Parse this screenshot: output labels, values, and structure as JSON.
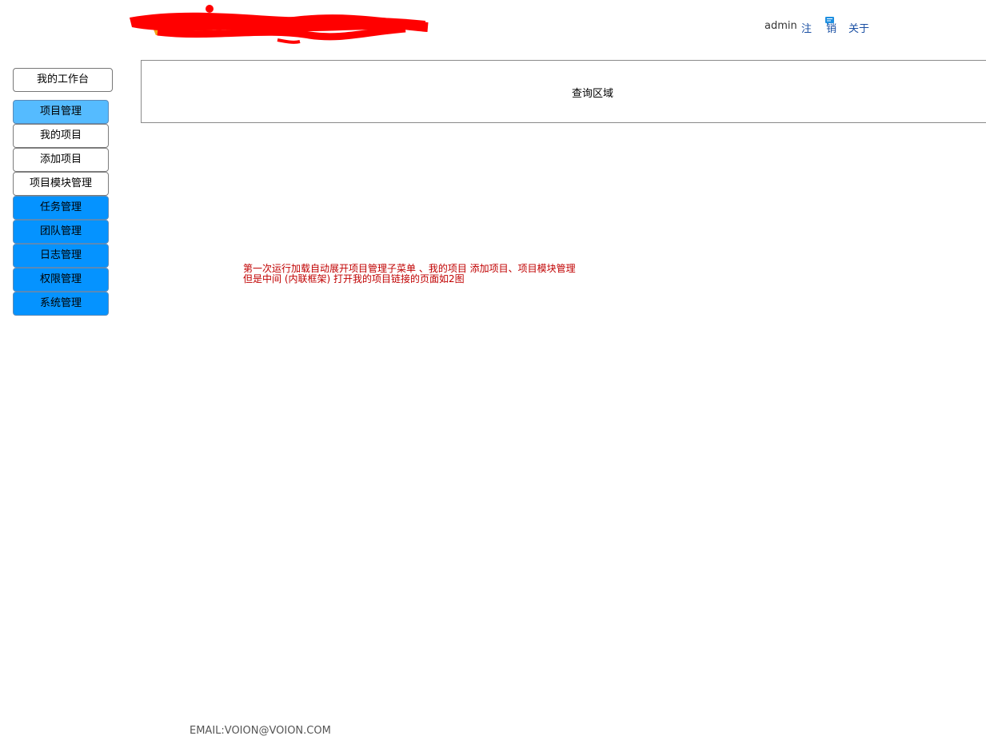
{
  "header": {
    "user": "admin",
    "logout": "注 销",
    "about": "关于"
  },
  "sidebar": {
    "workbench": "我的工作台",
    "menu": [
      {
        "label": "项目管理",
        "kind": "group",
        "active": true
      },
      {
        "label": "我的项目",
        "kind": "sub"
      },
      {
        "label": "添加项目",
        "kind": "sub"
      },
      {
        "label": "项目模块管理",
        "kind": "sub"
      },
      {
        "label": "任务管理",
        "kind": "group"
      },
      {
        "label": "团队管理",
        "kind": "group"
      },
      {
        "label": "日志管理",
        "kind": "group"
      },
      {
        "label": "权限管理",
        "kind": "group"
      },
      {
        "label": "系统管理",
        "kind": "group"
      }
    ]
  },
  "main": {
    "query_label": "查询区域",
    "note_lines": [
      "第一次运行加载自动展开项目管理子菜单 、我的项目  添加项目、项目模块管理",
      "但是中间 (内联框架) 打开我的项目链接的页面如2图"
    ]
  },
  "footer": {
    "email": "EMAIL:VOION@VOION.COM"
  },
  "colors": {
    "menu_group": "#0593ff",
    "menu_group_active": "#55bbff",
    "note_text": "#c00000",
    "link": "#1a4fa3",
    "scribble": "#ff0000",
    "logo_orange": "#f2a51a"
  },
  "icons": {
    "message": "message-icon",
    "logo": "redacted-logo"
  }
}
